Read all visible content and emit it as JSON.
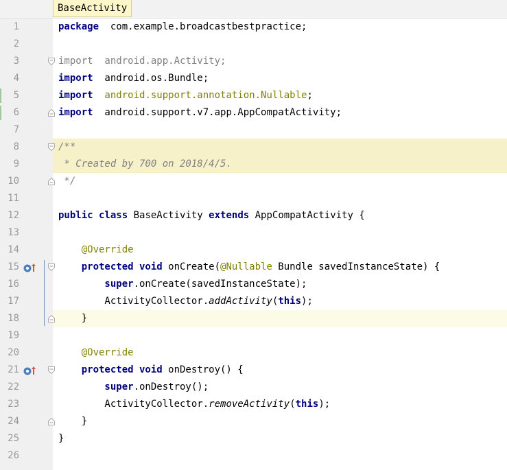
{
  "tab": {
    "title": "BaseActivity"
  },
  "lines": [
    {
      "n": "1",
      "tokens": [
        [
          "kw",
          "package"
        ],
        [
          "",
          "  com.example.broadcastbestpractice;"
        ]
      ]
    },
    {
      "n": "2",
      "tokens": []
    },
    {
      "n": "3",
      "tokens": [
        [
          "gray",
          "import"
        ],
        [
          "gray",
          "  android.app.Activity;"
        ]
      ],
      "fold": "open"
    },
    {
      "n": "4",
      "tokens": [
        [
          "kw",
          "import"
        ],
        [
          "",
          "  android.os.Bundle;"
        ]
      ]
    },
    {
      "n": "5",
      "tokens": [
        [
          "kw",
          "import"
        ],
        [
          "olive",
          "  android.support.annotation.Nullable"
        ],
        [
          "",
          ";"
        ]
      ]
    },
    {
      "n": "6",
      "tokens": [
        [
          "kw",
          "import"
        ],
        [
          "",
          "  android.support.v7.app.AppCompatActivity;"
        ]
      ],
      "fold": "close"
    },
    {
      "n": "7",
      "tokens": []
    },
    {
      "n": "8",
      "tokens": [
        [
          "cmt",
          "/**"
        ]
      ],
      "fold": "open",
      "bg": "comment"
    },
    {
      "n": "9",
      "tokens": [
        [
          "cmt",
          " * Created by 700 on 2018/4/5."
        ]
      ],
      "bg": "comment"
    },
    {
      "n": "10",
      "tokens": [
        [
          "cmt",
          " */"
        ]
      ],
      "fold": "close"
    },
    {
      "n": "11",
      "tokens": []
    },
    {
      "n": "12",
      "tokens": [
        [
          "kw",
          "public class"
        ],
        [
          "",
          " BaseActivity "
        ],
        [
          "kw",
          "extends"
        ],
        [
          "",
          " AppCompatActivity {"
        ]
      ]
    },
    {
      "n": "13",
      "tokens": []
    },
    {
      "n": "14",
      "tokens": [
        [
          "olive",
          "    @Override"
        ]
      ]
    },
    {
      "n": "15",
      "tokens": [
        [
          "kw",
          "    protected void"
        ],
        [
          "",
          " onCreate("
        ],
        [
          "olive",
          "@Nullable"
        ],
        [
          "",
          " Bundle savedInstanceState) {"
        ]
      ],
      "fold": "open",
      "marker": "override-up-icon"
    },
    {
      "n": "16",
      "tokens": [
        [
          "kw",
          "        super"
        ],
        [
          "",
          ".onCreate(savedInstanceState);"
        ]
      ]
    },
    {
      "n": "17",
      "tokens": [
        [
          "",
          "        ActivityCollector."
        ],
        [
          "it",
          "addActivity"
        ],
        [
          "",
          "("
        ],
        [
          "kw",
          "this"
        ],
        [
          "",
          ");"
        ]
      ]
    },
    {
      "n": "18",
      "tokens": [
        [
          "",
          "    }"
        ]
      ],
      "fold": "close",
      "bg": "current"
    },
    {
      "n": "19",
      "tokens": []
    },
    {
      "n": "20",
      "tokens": [
        [
          "olive",
          "    @Override"
        ]
      ]
    },
    {
      "n": "21",
      "tokens": [
        [
          "kw",
          "    protected void"
        ],
        [
          "",
          " onDestroy() {"
        ]
      ],
      "fold": "open",
      "marker": "override-up-icon"
    },
    {
      "n": "22",
      "tokens": [
        [
          "kw",
          "        super"
        ],
        [
          "",
          ".onDestroy();"
        ]
      ]
    },
    {
      "n": "23",
      "tokens": [
        [
          "",
          "        ActivityCollector."
        ],
        [
          "it",
          "removeActivity"
        ],
        [
          "",
          "("
        ],
        [
          "kw",
          "this"
        ],
        [
          "",
          ");"
        ]
      ]
    },
    {
      "n": "24",
      "tokens": [
        [
          "",
          "    }"
        ]
      ],
      "fold": "close"
    },
    {
      "n": "25",
      "tokens": [
        [
          "",
          "}"
        ]
      ]
    },
    {
      "n": "26",
      "tokens": []
    }
  ]
}
